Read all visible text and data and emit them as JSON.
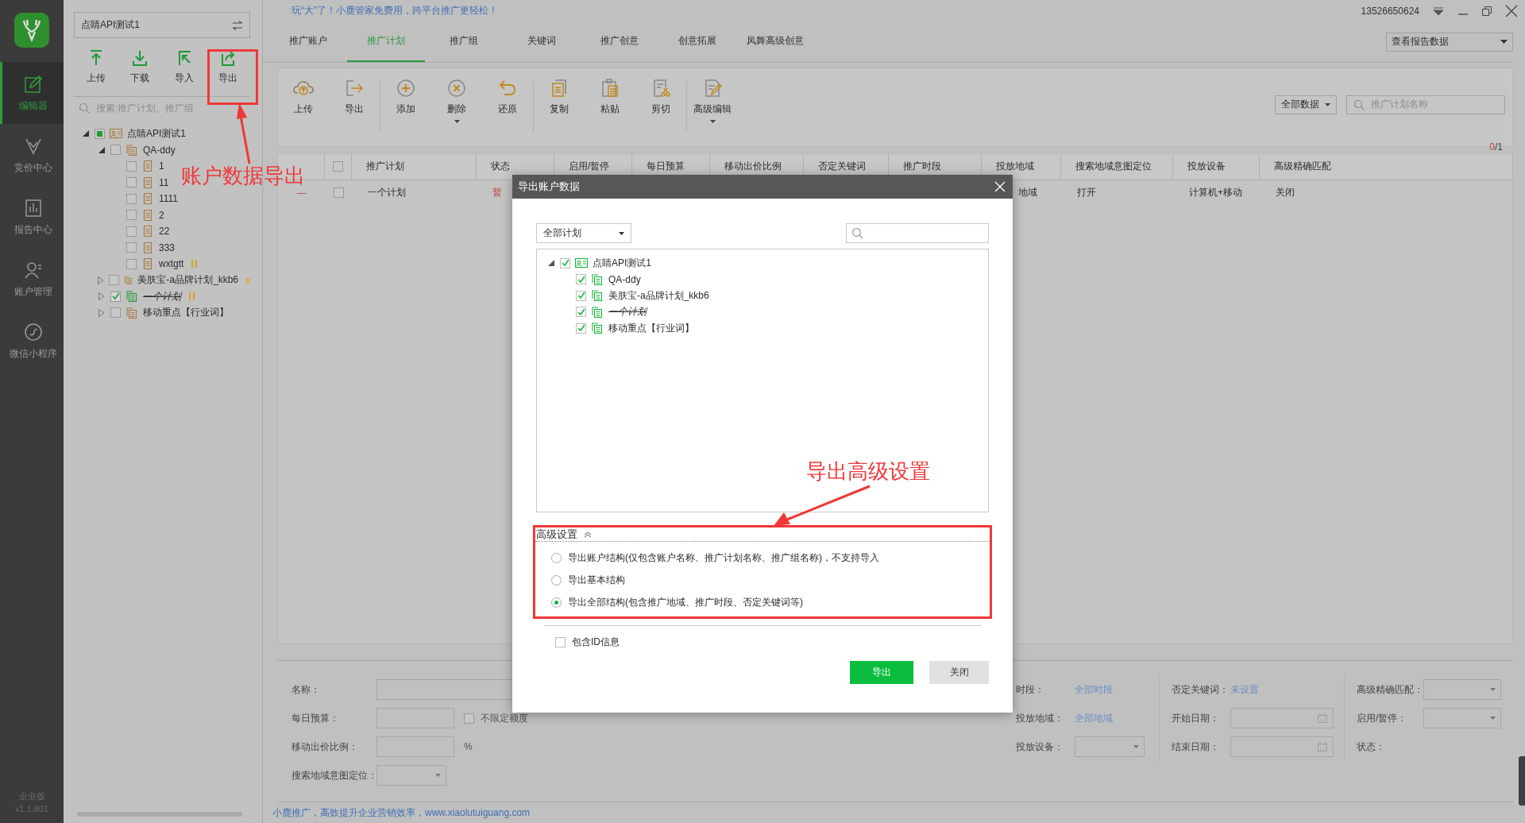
{
  "nav": {
    "items": [
      {
        "label": "编辑器",
        "selected": true
      },
      {
        "label": "竞价中心",
        "selected": false
      },
      {
        "label": "报告中心",
        "selected": false
      },
      {
        "label": "账户管理",
        "selected": false
      },
      {
        "label": "微信小程序",
        "selected": false
      }
    ],
    "edition": "企业版",
    "version": "v1.1.801"
  },
  "side_panel": {
    "account": "点睛API测试1",
    "tools": [
      "上传",
      "下载",
      "导入",
      "导出"
    ],
    "search_placeholder": "搜索:推广计划、推广组",
    "tree": [
      {
        "label": "点睛API测试1",
        "kind": "account",
        "checked": false,
        "mixed": true,
        "expanded": true,
        "children": [
          {
            "label": "QA-ddy",
            "kind": "plan",
            "checked": false,
            "expanded": true,
            "paused": false,
            "deleted": false,
            "children": [
              {
                "label": "1",
                "kind": "group",
                "checked": false,
                "paused": false,
                "deleted": false
              },
              {
                "label": "11",
                "kind": "group",
                "checked": false,
                "paused": false,
                "deleted": false
              },
              {
                "label": "1111",
                "kind": "group",
                "checked": false,
                "paused": false,
                "deleted": false
              },
              {
                "label": "2",
                "kind": "group",
                "checked": false,
                "paused": false,
                "deleted": false
              },
              {
                "label": "22",
                "kind": "group",
                "checked": false,
                "paused": false,
                "deleted": false
              },
              {
                "label": "333",
                "kind": "group",
                "checked": false,
                "paused": false,
                "deleted": false
              },
              {
                "label": "wxtgtt",
                "kind": "group",
                "checked": false,
                "paused": true,
                "deleted": false
              }
            ]
          },
          {
            "label": "美肤宝-a品牌计划_kkb6",
            "kind": "plan",
            "checked": false,
            "expanded": false,
            "paused": true,
            "deleted": false
          },
          {
            "label": "一个计划",
            "kind": "plan",
            "checked": true,
            "expanded": false,
            "paused": true,
            "deleted": true
          },
          {
            "label": "移动重点【行业词】",
            "kind": "plan",
            "checked": false,
            "expanded": false,
            "paused": false,
            "deleted": false
          }
        ]
      }
    ]
  },
  "banner": "玩“大”了！小鹿管家免费用，跨平台推广更轻松！",
  "window": {
    "user": "13526650624"
  },
  "tabs": [
    {
      "label": "推广账户",
      "selected": false
    },
    {
      "label": "推广计划",
      "selected": true
    },
    {
      "label": "推广组",
      "selected": false
    },
    {
      "label": "关键词",
      "selected": false
    },
    {
      "label": "推广创意",
      "selected": false
    },
    {
      "label": "创意拓展",
      "selected": false
    },
    {
      "label": "凤舞高级创意",
      "selected": false
    }
  ],
  "report_select": "查看报告数据",
  "toolbar": {
    "groups": [
      [
        {
          "label": "上传",
          "menu": false
        },
        {
          "label": "导出",
          "menu": false
        }
      ],
      [
        {
          "label": "添加",
          "menu": false
        },
        {
          "label": "删除",
          "menu": true
        },
        {
          "label": "还原",
          "menu": false
        }
      ],
      [
        {
          "label": "复制",
          "menu": false
        },
        {
          "label": "粘贴",
          "menu": false
        },
        {
          "label": "剪切",
          "menu": false
        }
      ],
      [
        {
          "label": "高级编辑",
          "menu": true
        }
      ]
    ],
    "filter": "全部数据",
    "search_placeholder": "推广计划名称",
    "selected_count": "0",
    "of_total": "/1"
  },
  "table": {
    "columns": [
      "推广计划",
      "状态",
      "启用/暂停",
      "每日预算",
      "移动出价比例",
      "否定关键词",
      "推广时段",
      "投放地域",
      "搜索地域意图定位",
      "投放设备",
      "高级精确匹配"
    ],
    "select_all": {
      "checked": false
    },
    "rows": [
      {
        "marker": "—",
        "checked": false,
        "cells": [
          "一个计划",
          "暂",
          null,
          null,
          null,
          null,
          null,
          "地域",
          "打开",
          "计算机+移动",
          "关闭"
        ]
      }
    ]
  },
  "editor_form": {
    "left": [
      {
        "label": "名称：",
        "kind": "input"
      },
      {
        "label": "每日预算：",
        "kind": "input",
        "option": {
          "label": "不限定额度",
          "checked": false
        }
      },
      {
        "label": "移动出价比例：",
        "kind": "input",
        "unit": "%"
      },
      {
        "label": "搜索地域意图定位：",
        "kind": "select"
      }
    ],
    "columns": [
      [
        {
          "label": "时段：",
          "kind": "link",
          "value": "全部时段"
        },
        {
          "label": "投放地域：",
          "kind": "link",
          "value": "全部地域"
        },
        {
          "label": "投放设备：",
          "kind": "select"
        }
      ],
      [
        {
          "label": "否定关键词：",
          "kind": "link",
          "value": "未设置"
        },
        {
          "label": "开始日期：",
          "kind": "date"
        },
        {
          "label": "结束日期：",
          "kind": "date"
        }
      ],
      [
        {
          "label": "高级精确匹配：",
          "kind": "select"
        },
        {
          "label": "启用/暂停：",
          "kind": "select"
        },
        {
          "label": "状态：",
          "kind": "text"
        }
      ]
    ]
  },
  "footer": "小鹿推广，高效提升企业营销效率，www.xiaolutuiguang.com",
  "dialog": {
    "title": "导出账户数据",
    "scope": "全部计划",
    "tree": [
      {
        "label": "点睛API测试1",
        "kind": "account",
        "checked": true,
        "expanded": true,
        "deleted": false,
        "children": [
          {
            "label": "QA-ddy",
            "kind": "plan",
            "checked": true,
            "deleted": false
          },
          {
            "label": "美肤宝-a品牌计划_kkb6",
            "kind": "plan",
            "checked": true,
            "deleted": false
          },
          {
            "label": "一个计划",
            "kind": "plan",
            "checked": true,
            "deleted": true
          },
          {
            "label": "移动重点【行业词】",
            "kind": "plan",
            "checked": true,
            "deleted": false
          }
        ]
      }
    ],
    "advanced": {
      "title": "高级设置",
      "expanded": true,
      "options": [
        {
          "label": "导出账户结构(仅包含账户名称、推广计划名称、推广组名称)，不支持导入",
          "selected": false
        },
        {
          "label": "导出基本结构",
          "selected": false
        },
        {
          "label": "导出全部结构(包含推广地域、推广时段、否定关键词等)",
          "selected": true
        }
      ]
    },
    "include_id": {
      "label": "包含ID信息",
      "checked": false
    },
    "buttons": [
      {
        "label": "导出",
        "kind": "primary"
      },
      {
        "label": "关闭",
        "kind": "secondary"
      }
    ]
  },
  "annotations": [
    {
      "text": "账户数据导出"
    },
    {
      "text": "导出高级设置"
    }
  ]
}
